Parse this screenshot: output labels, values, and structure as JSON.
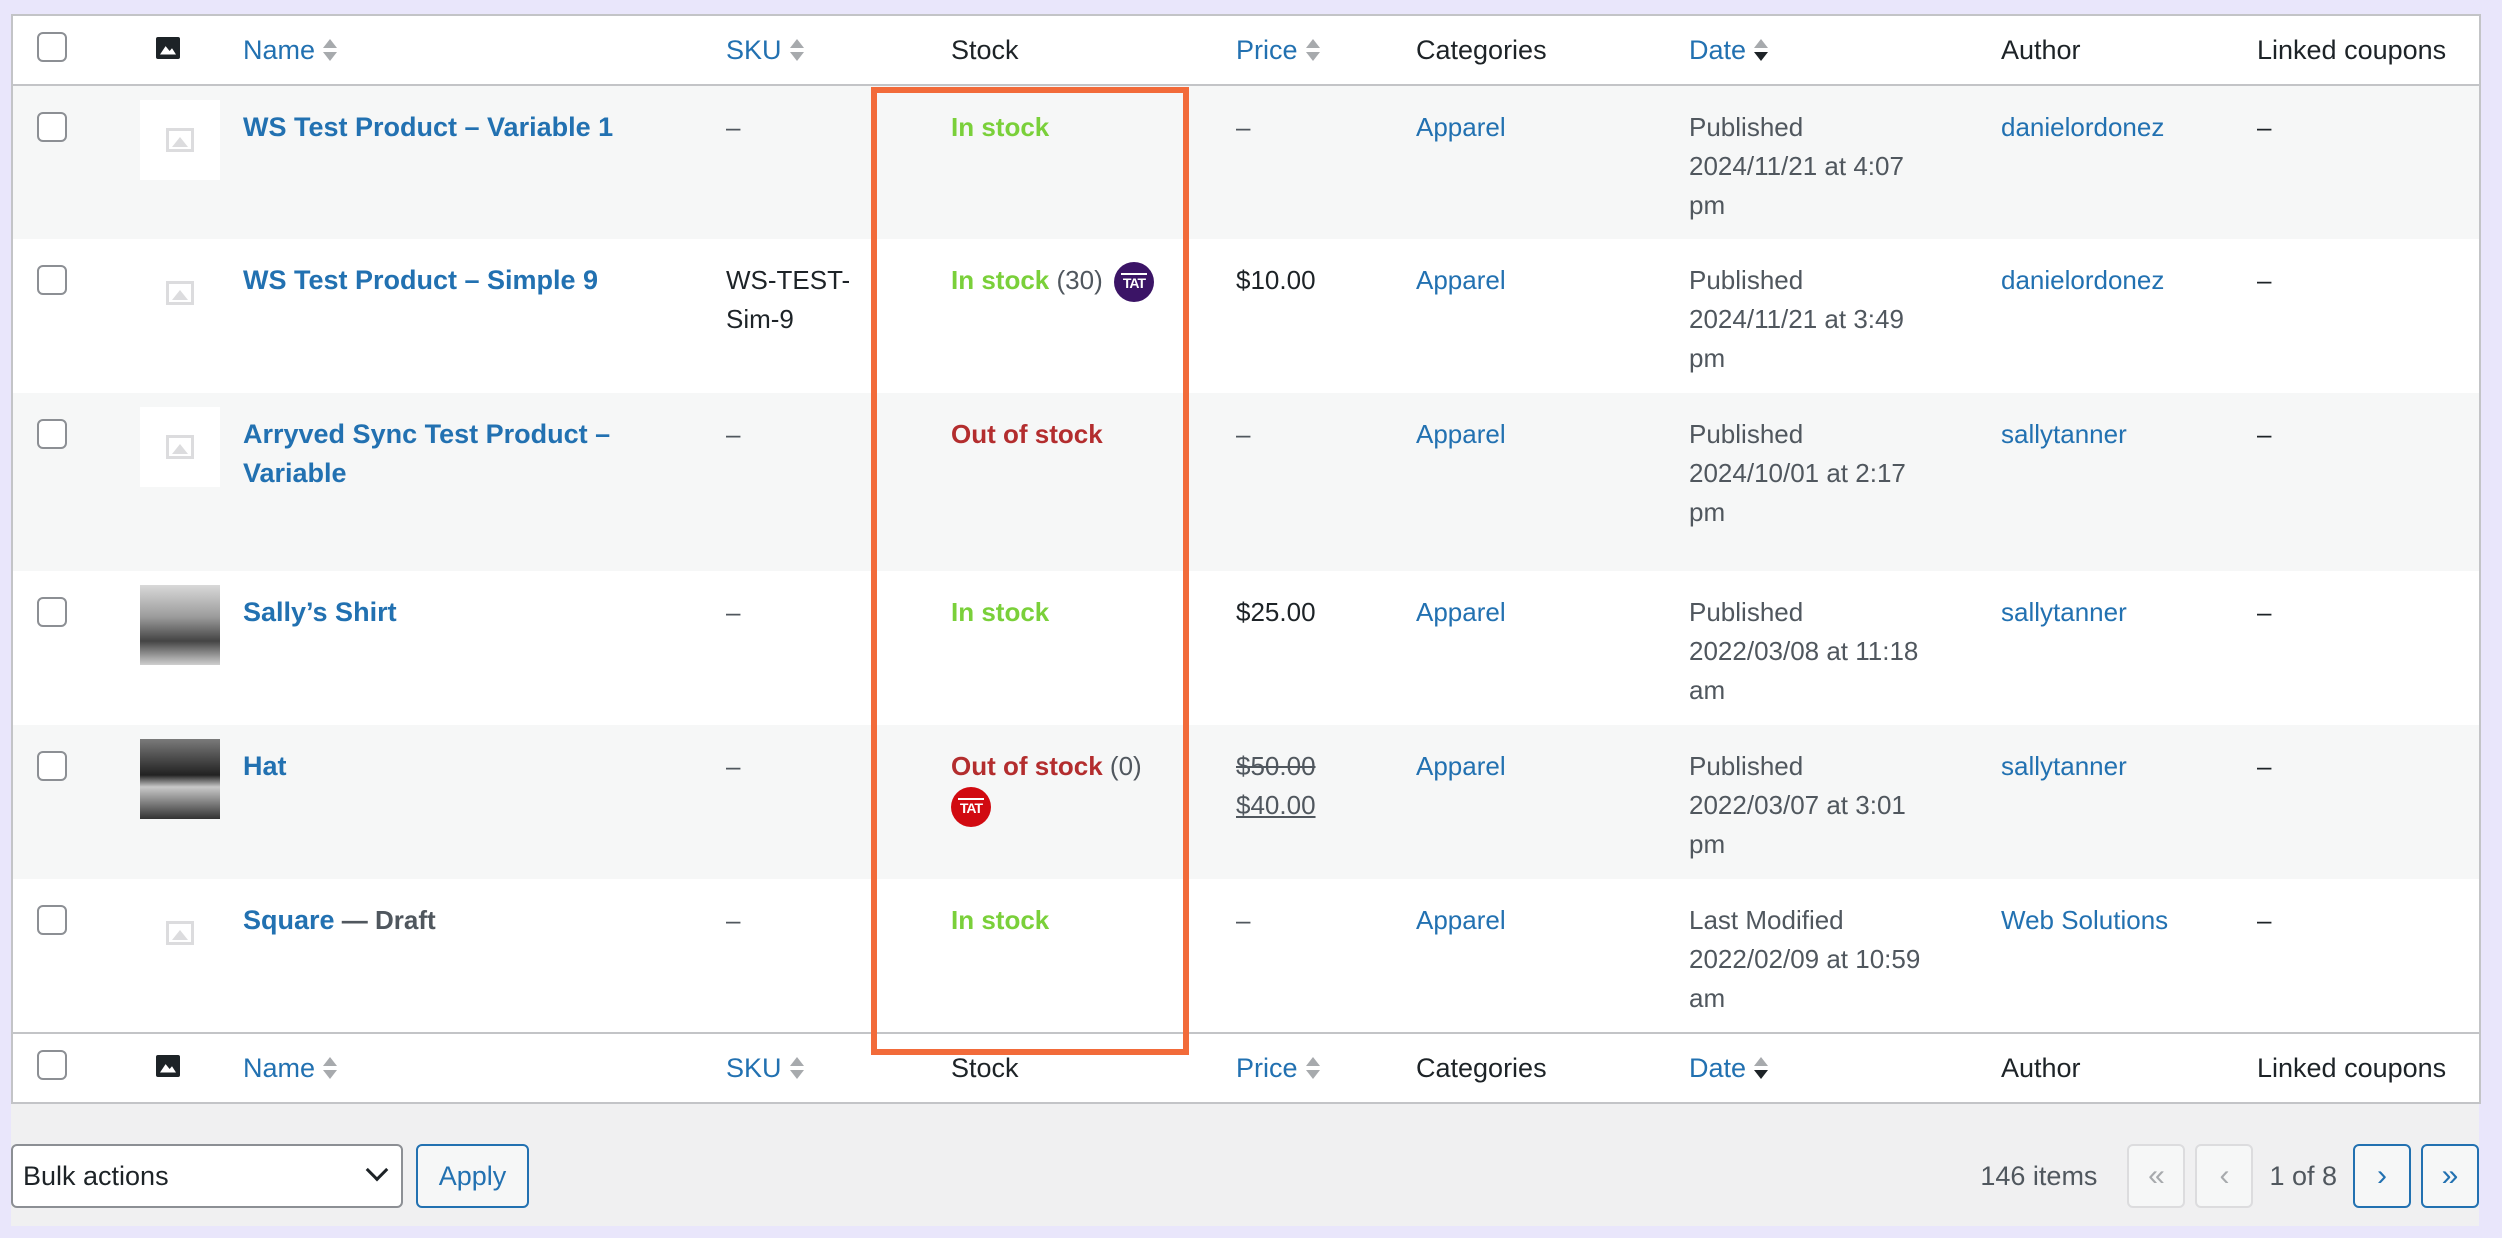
{
  "columns": {
    "name": "Name",
    "sku": "SKU",
    "stock": "Stock",
    "price": "Price",
    "categories": "Categories",
    "date": "Date",
    "author": "Author",
    "linked_coupons": "Linked coupons"
  },
  "rows": [
    {
      "name": "WS Test Product – Variable 1",
      "sku": "–",
      "stock": "In stock",
      "qty": "",
      "price": "–",
      "category": "Apparel",
      "date_l1": "Published",
      "date_l2": "2024/11/21 at 4:07",
      "date_l3": "pm",
      "author": "danielordonez",
      "coupons": "–"
    },
    {
      "name": "WS Test Product – Simple 9",
      "sku_l1": "WS-TEST-",
      "sku_l2": "Sim-9",
      "stock": "In stock",
      "qty": "(30)",
      "price": "$10.00",
      "category": "Apparel",
      "date_l1": "Published",
      "date_l2": "2024/11/21 at 3:49",
      "date_l3": "pm",
      "author": "danielordonez",
      "coupons": "–"
    },
    {
      "name_l1": "Arryved Sync Test Product –",
      "name_l2": "Variable",
      "sku": "–",
      "stock": "Out of stock",
      "price": "–",
      "category": "Apparel",
      "date_l1": "Published",
      "date_l2": "2024/10/01 at 2:17",
      "date_l3": "pm",
      "author": "sallytanner",
      "coupons": "–"
    },
    {
      "name": "Sally’s Shirt",
      "sku": "–",
      "stock": "In stock",
      "price": "$25.00",
      "category": "Apparel",
      "date_l1": "Published",
      "date_l2": "2022/03/08 at 11:18",
      "date_l3": "am",
      "author": "sallytanner",
      "coupons": "–"
    },
    {
      "name": "Hat",
      "sku": "–",
      "stock": "Out of stock",
      "qty": "(0)",
      "price_old": "$50.00",
      "price_new": "$40.00",
      "category": "Apparel",
      "date_l1": "Published",
      "date_l2": "2022/03/07 at 3:01",
      "date_l3": "pm",
      "author": "sallytanner",
      "coupons": "–"
    },
    {
      "name": "Square",
      "status": "— Draft",
      "sku": "–",
      "stock": "In stock",
      "price": "–",
      "category": "Apparel",
      "date_l1": "Last Modified",
      "date_l2": "2022/02/09 at 10:59",
      "date_l3": "am",
      "author": "Web Solutions",
      "coupons": "–"
    }
  ],
  "badge_text": "TAT",
  "colors": {
    "in_stock": "#7ad03a",
    "out_of_stock": "#b32d2e",
    "link": "#2271b1",
    "highlight": "#f26b3a",
    "badge_purple": "#3b1466",
    "badge_red": "#d10a11"
  },
  "bottom": {
    "bulk_actions": "Bulk actions",
    "apply": "Apply",
    "items_count": "146 items",
    "first": "«",
    "prev": "‹",
    "page_of": "1 of 8",
    "next": "›",
    "last": "»"
  }
}
